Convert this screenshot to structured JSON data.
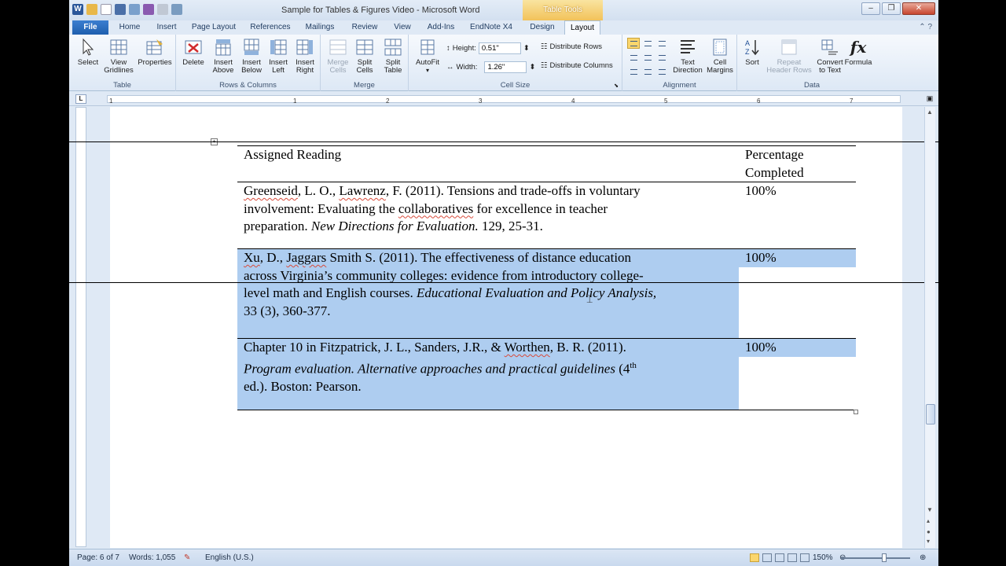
{
  "window": {
    "title": "Sample for Tables & Figures Video  -  Microsoft Word",
    "context_tab": "Table Tools",
    "controls": [
      "–",
      "❐",
      "✕"
    ]
  },
  "tabs": [
    "File",
    "Home",
    "Insert",
    "Page Layout",
    "References",
    "Mailings",
    "Review",
    "View",
    "Add-Ins",
    "EndNote X4",
    "Design",
    "Layout"
  ],
  "ribbon": {
    "table_group": {
      "label": "Table",
      "select": "Select",
      "view_gridlines": "View Gridlines",
      "properties": "Properties"
    },
    "rows_columns_group": {
      "label": "Rows & Columns",
      "delete": "Delete",
      "insert_above": "Insert Above",
      "insert_below": "Insert Below",
      "insert_left": "Insert Left",
      "insert_right": "Insert Right"
    },
    "merge_group": {
      "label": "Merge",
      "merge_cells": "Merge Cells",
      "split_cells": "Split Cells",
      "split_table": "Split Table"
    },
    "cell_size_group": {
      "label": "Cell Size",
      "autofit": "AutoFit",
      "height_label": "Height:",
      "height_value": "0.51\"",
      "width_label": "Width:",
      "width_value": "1.26\"",
      "distribute_rows": "Distribute Rows",
      "distribute_columns": "Distribute Columns"
    },
    "alignment_group": {
      "label": "Alignment",
      "text_direction": "Text Direction",
      "cell_margins": "Cell Margins"
    },
    "data_group": {
      "label": "Data",
      "sort": "Sort",
      "repeat_header_rows": "Repeat Header Rows",
      "convert_to_text": "Convert to Text",
      "formula": "Formula"
    }
  },
  "ruler": {
    "marks": [
      "1",
      "1",
      "2",
      "3",
      "4",
      "5",
      "6",
      "7"
    ]
  },
  "document": {
    "header_col1": "Assigned Reading",
    "header_col2_line1": "Percentage",
    "header_col2_line2": "Completed",
    "rows": [
      {
        "a1": "Greenseid",
        "a2": ", L. O., ",
        "a3": "Lawrenz",
        "a4": ", F. (2011).  Tensions and trade-offs in voluntary",
        "b1": "involvement: Evaluating the ",
        "b2": "collaboratives",
        "b3": " for excellence in teacher",
        "c1": "preparation. ",
        "c2": "New Directions for Evaluation.",
        "c3": " 129, 25-31.",
        "pct": "100%"
      },
      {
        "a1": "Xu",
        "a2": ", D., ",
        "a3": "Jaggars",
        "a4": " Smith S. (2011).  The effectiveness of distance education",
        "b1": "across Virginia’s community colleges: evidence from introductory college-",
        "c1": "level math and English courses.  ",
        "c2": "Educational Evaluation and Policy Analysis,",
        "d1": "33 (3), 360-377.",
        "pct": "100%"
      },
      {
        "a1": "Chapter 10 in Fitzpatrick, J. L., Sanders, J.R., & ",
        "a2": "Worthen",
        "a3": ", B. R. (2011).",
        "b1": "Program evaluation.  Alternative approaches and practical guidelines",
        "b2": " (4",
        "b3": "th",
        "c1": "ed.). Boston: Pearson.",
        "pct": "100%"
      }
    ]
  },
  "status": {
    "page": "Page: 6 of 7",
    "words": "Words: 1,055",
    "language": "English (U.S.)",
    "zoom": "150%"
  }
}
